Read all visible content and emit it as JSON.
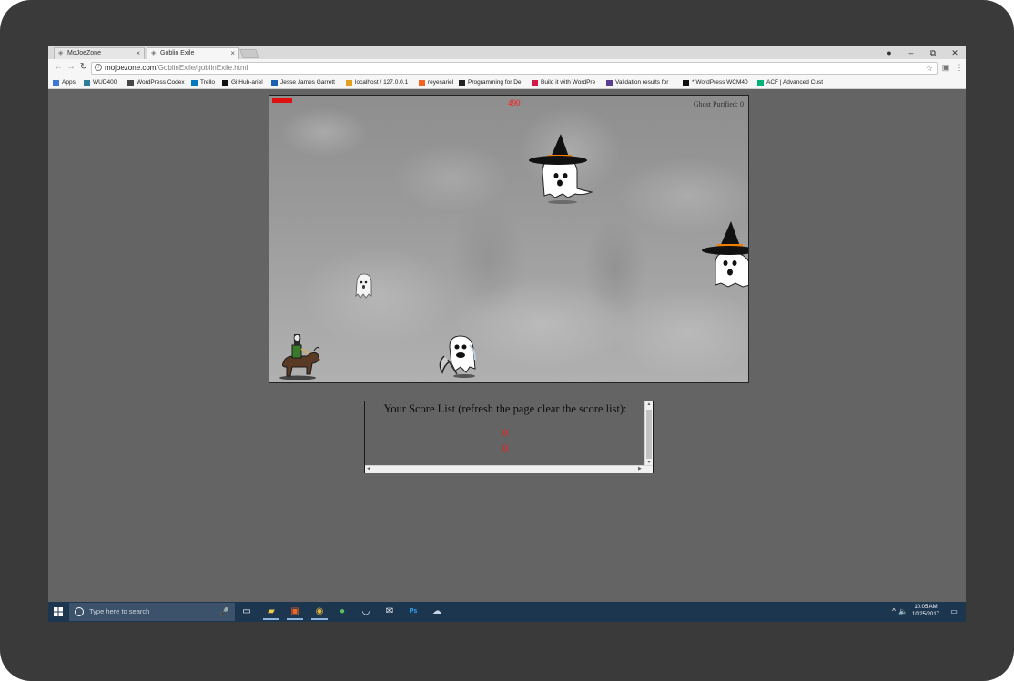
{
  "browser": {
    "tabs": [
      {
        "label": "MoJoeZone",
        "active": false
      },
      {
        "label": "Goblin Exile",
        "active": true
      }
    ],
    "window_controls": {
      "minimize": "–",
      "restore": "⧉",
      "close": "✕"
    },
    "url_host": "mojoezone.com",
    "url_path": "/GoblinExile/goblinExile.html",
    "bookmarks": [
      {
        "label": "Apps",
        "icon": "apps-grid-icon",
        "color": "#3c78d8"
      },
      {
        "label": "WUD400",
        "icon": "hmm-icon",
        "color": "#2e7d9a"
      },
      {
        "label": "WordPress Codex",
        "icon": "wordpress-icon",
        "color": "#464646"
      },
      {
        "label": "Trello",
        "icon": "trello-icon",
        "color": "#0079bf"
      },
      {
        "label": "GitHub-ariel",
        "icon": "github-icon",
        "color": "#111111"
      },
      {
        "label": "Jesse James Garrett",
        "icon": "blue-square-icon",
        "color": "#1a5fb4"
      },
      {
        "label": "localhost / 127.0.0.1",
        "icon": "phpmyadmin-icon",
        "color": "#e6a020"
      },
      {
        "label": "reyesariel",
        "icon": "orange-box-icon",
        "color": "#f26522"
      },
      {
        "label": "Programming for De",
        "icon": "p-icon",
        "color": "#222222"
      },
      {
        "label": "Build it with WordPre",
        "icon": "red-square-icon",
        "color": "#d11a4a"
      },
      {
        "label": "Validation results for",
        "icon": "w3c-icon",
        "color": "#5a3e8f"
      },
      {
        "label": "* WordPress WCM40",
        "icon": "black-square-icon",
        "color": "#111111"
      },
      {
        "label": "ACF | Advanced Cust",
        "icon": "acf-icon",
        "color": "#00b27a"
      }
    ]
  },
  "game": {
    "timer": "490",
    "ghost_counter": "Ghost Purified: 0",
    "health_fraction": 1.0,
    "colors": {
      "health": "#e01010",
      "timer": "#ff1a1a"
    }
  },
  "score_list": {
    "title": "Your Score List (refresh the page clear the score list):",
    "scores": [
      "0",
      "0"
    ]
  },
  "taskbar": {
    "search_placeholder": "Type here to search",
    "clock_time": "10:05 AM",
    "clock_date": "10/25/2017",
    "apps": [
      "task-view-icon",
      "file-explorer-icon",
      "xampp-icon",
      "chrome-icon",
      "green-app-icon",
      "mask-icon",
      "mail-icon",
      "photoshop-icon",
      "cloud-app-icon"
    ]
  }
}
